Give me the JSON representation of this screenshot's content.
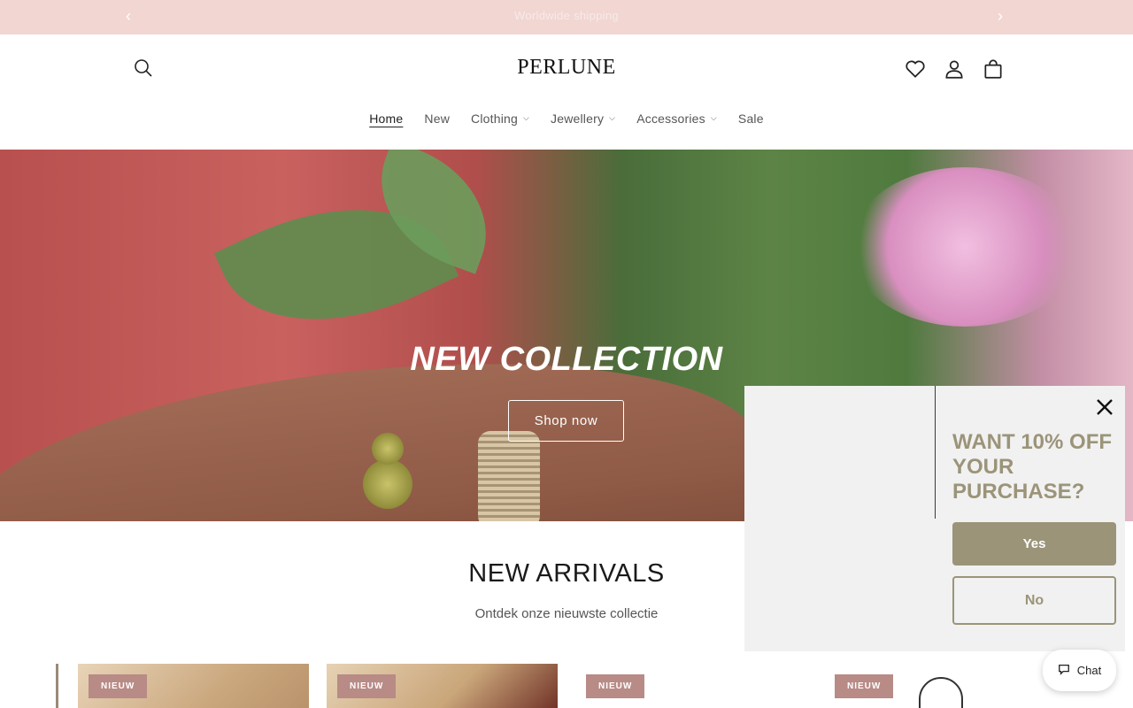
{
  "announcement": {
    "text": "Worldwide shipping",
    "prev_icon": "chevron-left-icon",
    "next_icon": "chevron-right-icon"
  },
  "header": {
    "logo": "PERLUNE",
    "icons": [
      "search-icon",
      "heart-icon",
      "user-icon",
      "bag-icon"
    ]
  },
  "nav": {
    "home": "Home",
    "new": "New",
    "clothing": "Clothing",
    "jewellery": "Jewellery",
    "accessories": "Accessories",
    "sale": "Sale"
  },
  "hero": {
    "title": "NEW COLLECTION",
    "button": "Shop now"
  },
  "arrivals": {
    "title": "NEW ARRIVALS",
    "subtitle": "Ontdek onze nieuwste collectie",
    "badges": [
      "NIEUW",
      "NIEUW",
      "NIEUW",
      "NIEUW"
    ]
  },
  "popup": {
    "headline": "WANT 10% OFF YOUR PURCHASE?",
    "yes": "Yes",
    "no": "No",
    "accent": "#9b9479"
  },
  "chat": {
    "label": "Chat"
  },
  "colors": {
    "announcement_bg": "#f2d6d2",
    "badge_bg": "#b88b86"
  }
}
